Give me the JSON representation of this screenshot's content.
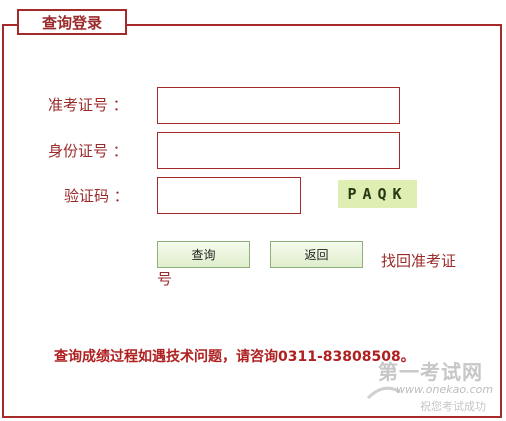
{
  "panel": {
    "title": "查询登录"
  },
  "form": {
    "exam_id_label": "准考证号 ：",
    "id_card_label": "身份证号 ：",
    "captcha_label": "验证码 ：",
    "exam_id_value": "",
    "id_card_value": "",
    "captcha_value": "",
    "captcha_image_text": "PAQK"
  },
  "buttons": {
    "query": "查询",
    "back": "返回"
  },
  "links": {
    "recover_line1": "找回准考证",
    "recover_line2": "号"
  },
  "notice": "查询成绩过程如遇技术问题，请咨询0311-83808508。",
  "watermark": {
    "main": "第一考试网",
    "url": "www.onekao.com",
    "sub": "祝您考试成功"
  }
}
